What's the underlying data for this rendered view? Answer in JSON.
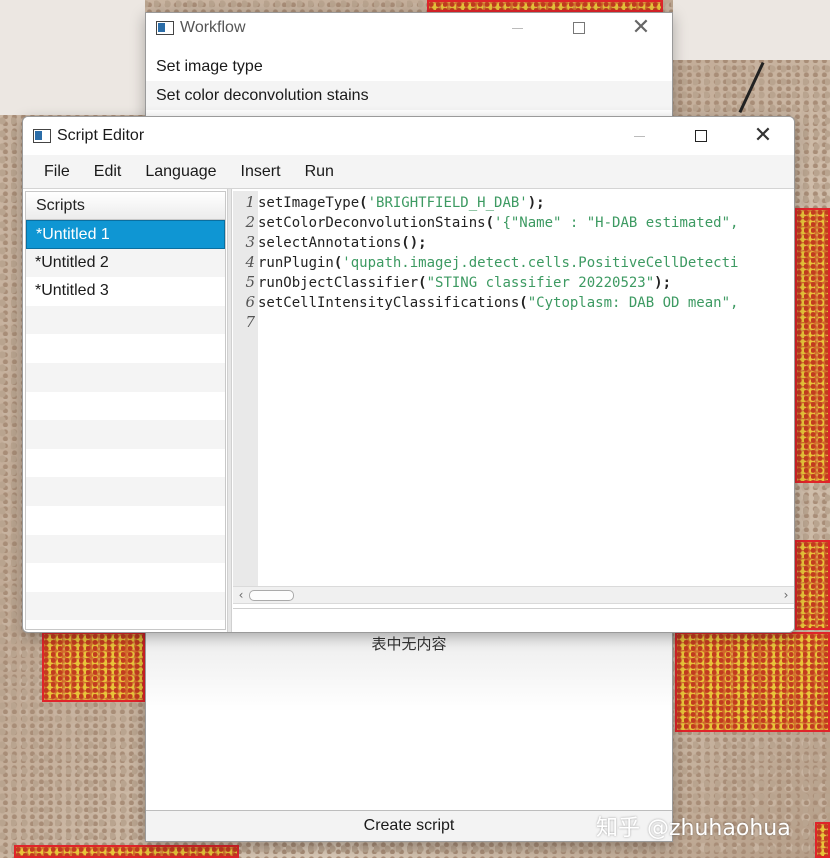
{
  "workflow_window": {
    "title": "Workflow",
    "steps": [
      "Set image type",
      "Set color deconvolution stains"
    ],
    "empty_text": "表中无内容",
    "create_script_label": "Create script"
  },
  "editor_window": {
    "title": "Script Editor",
    "menu": [
      "File",
      "Edit",
      "Language",
      "Insert",
      "Run"
    ],
    "scripts_header": "Scripts",
    "scripts": [
      "*Untitled 1",
      "*Untitled 2",
      "*Untitled 3"
    ],
    "selected_script": "*Untitled 1",
    "code_lines": [
      {
        "n": "1",
        "fn": "setImageType",
        "arg": "'BRIGHTFIELD_H_DAB'",
        "tail": ");"
      },
      {
        "n": "2",
        "fn": "setColorDeconvolutionStains",
        "arg": "'{\"Name\" : \"H-DAB estimated\",",
        "tail": ""
      },
      {
        "n": "3",
        "fn": "selectAnnotations",
        "arg": "",
        "tail": ");"
      },
      {
        "n": "4",
        "fn": "runPlugin",
        "arg": "'qupath.imagej.detect.cells.PositiveCellDetecti",
        "tail": ""
      },
      {
        "n": "5",
        "fn": "runObjectClassifier",
        "arg": "\"STING classifier 20220523\"",
        "tail": ");"
      },
      {
        "n": "6",
        "fn": "setCellIntensityClassifications",
        "arg": "\"Cytoplasm: DAB OD mean\",",
        "tail": ""
      },
      {
        "n": "7",
        "fn": "",
        "arg": "",
        "tail": ""
      }
    ]
  },
  "window_controls": {
    "minimize": "minimize-icon",
    "maximize": "maximize-icon",
    "close": "close-icon"
  },
  "watermark": "知乎 @zhuhaohua",
  "colors": {
    "selection": "#0f96d3",
    "string": "#3d9a62",
    "annotation_border": "#e0242a"
  }
}
